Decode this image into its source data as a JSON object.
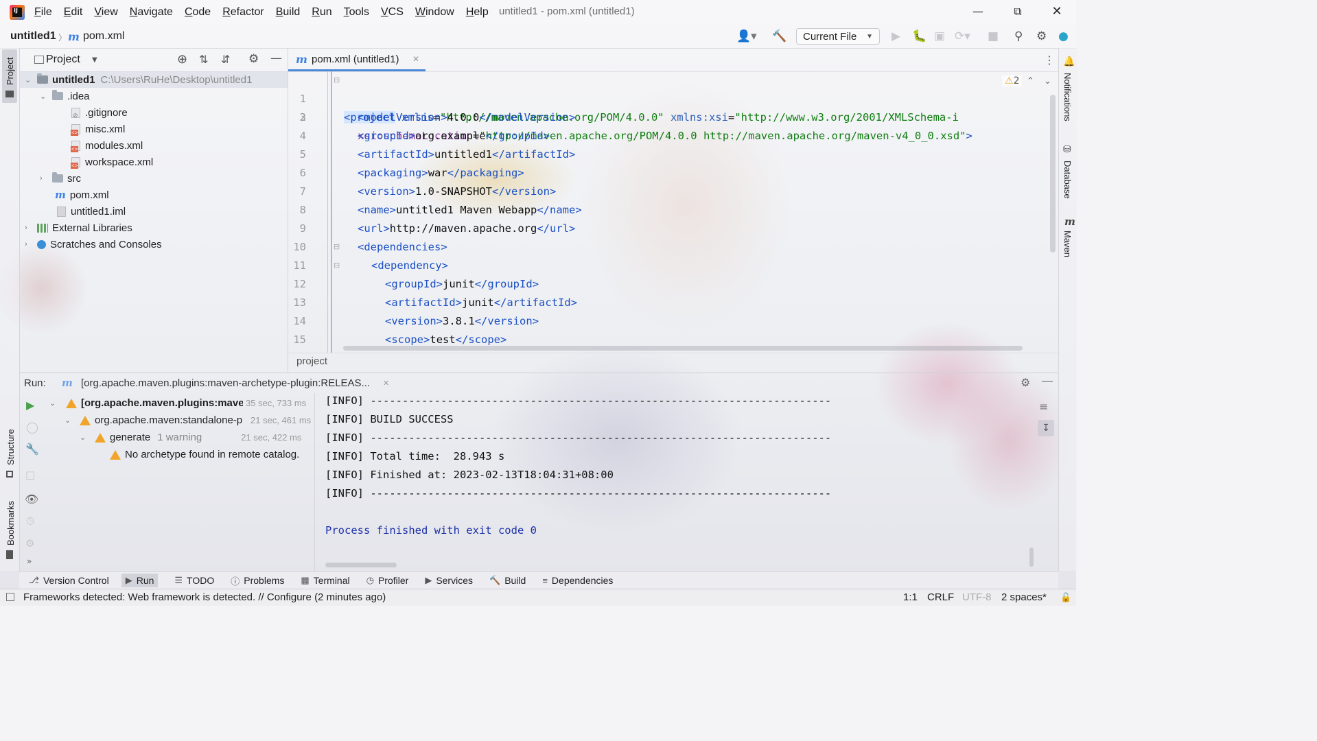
{
  "window": {
    "title": "untitled1 - pom.xml (untitled1)",
    "logo_text": "IJ"
  },
  "menu": [
    {
      "u": "F",
      "rest": "ile"
    },
    {
      "u": "E",
      "rest": "dit"
    },
    {
      "u": "V",
      "rest": "iew"
    },
    {
      "u": "N",
      "rest": "avigate"
    },
    {
      "u": "C",
      "rest": "ode"
    },
    {
      "u": "R",
      "rest": "efactor"
    },
    {
      "u": "B",
      "rest": "uild"
    },
    {
      "u": "R",
      "rest": "un"
    },
    {
      "u": "T",
      "rest": "ools"
    },
    {
      "u": "V",
      "rest": "CS"
    },
    {
      "u": "W",
      "rest": "indow"
    },
    {
      "u": "H",
      "rest": "elp"
    }
  ],
  "navbar": {
    "project": "untitled1",
    "separator": "〉",
    "file_icon": "m",
    "file": "pom.xml",
    "run_config": "Current File"
  },
  "left_stripe": {
    "project": "Project",
    "structure": "Structure",
    "bookmarks": "Bookmarks"
  },
  "right_stripe": {
    "notifications": "Notifications",
    "database": "Database",
    "maven": "Maven"
  },
  "project_panel": {
    "title": "Project",
    "tree": {
      "root": "untitled1",
      "root_path": "C:\\Users\\RuHe\\Desktop\\untitled1",
      "idea": ".idea",
      "gitignore": ".gitignore",
      "misc": "misc.xml",
      "modules": "modules.xml",
      "workspace": "workspace.xml",
      "src": "src",
      "pom": "pom.xml",
      "iml": "untitled1.iml",
      "libs": "External Libraries",
      "scratches": "Scratches and Consoles"
    }
  },
  "editor": {
    "tab_label": "pom.xml (untitled1)",
    "warning_count": "2",
    "breadcrumb": "project",
    "line_numbers": [
      "1",
      "2",
      "3",
      "4",
      "5",
      "6",
      "7",
      "8",
      "9",
      "10",
      "11",
      "12",
      "13",
      "14",
      "15"
    ]
  },
  "run": {
    "label": "Run:",
    "tab": "[org.apache.maven.plugins:maven-archetype-plugin:RELEAS...",
    "tree": [
      {
        "text": "[org.apache.maven.plugins:mave",
        "time": "35 sec, 733 ms"
      },
      {
        "text": "org.apache.maven:standalone-p",
        "time": "21 sec, 461 ms"
      },
      {
        "text": "generate",
        "extra": "1 warning",
        "time": "21 sec, 422 ms"
      },
      {
        "text": "No archetype found in remote catalog."
      }
    ],
    "console": [
      "[INFO] ------------------------------------------------------------------------",
      "[INFO] BUILD SUCCESS",
      "[INFO] ------------------------------------------------------------------------",
      "[INFO] Total time:  28.943 s",
      "[INFO] Finished at: 2023-02-13T18:04:31+08:00",
      "[INFO] ------------------------------------------------------------------------",
      "",
      "Process finished with exit code 0"
    ]
  },
  "tool_windows": [
    "Version Control",
    "Run",
    "TODO",
    "Problems",
    "Terminal",
    "Profiler",
    "Services",
    "Build",
    "Dependencies"
  ],
  "status": {
    "message": "Frameworks detected: Web framework is detected. // Configure (2 minutes ago)",
    "position": "1:1",
    "line_sep": "CRLF",
    "encoding": "UTF-8",
    "indent": "2 spaces*"
  },
  "code": {
    "l1": {
      "open": "<",
      "name": "project",
      "a1": " xmlns",
      "eq1": "=",
      "v1": "\"http://maven.apache.org/POM/4.0.0\"",
      "a2": " xmlns:xsi",
      "eq2": "=",
      "v2": "\"http://www.w3.org/2001/XMLSchema-i"
    },
    "l2": {
      "ns": "xsi:schemaLocation",
      "eq": "=",
      "v": "\"http://maven.apache.org/POM/4.0.0 http://maven.apache.org/maven-v4_0_0.xsd\"",
      "close": ">"
    },
    "l3": {
      "tag": "modelVersion",
      "val": "4.0.0"
    },
    "l4": {
      "tag": "groupId",
      "val": "org.example"
    },
    "l5": {
      "tag": "artifactId",
      "val": "untitled1"
    },
    "l6": {
      "tag": "packaging",
      "val": "war"
    },
    "l7": {
      "tag": "version",
      "val": "1.0-SNAPSHOT"
    },
    "l8": {
      "tag": "name",
      "val": "untitled1 Maven Webapp"
    },
    "l9": {
      "tag": "url",
      "val": "http://maven.apache.org"
    },
    "l10": {
      "tag": "dependencies"
    },
    "l11": {
      "tag": "dependency"
    },
    "l12": {
      "tag": "groupId",
      "val": "junit"
    },
    "l13": {
      "tag": "artifactId",
      "val": "junit"
    },
    "l14": {
      "tag": "version",
      "val": "3.8.1"
    },
    "l15": {
      "tag": "scope",
      "val": "test"
    }
  }
}
